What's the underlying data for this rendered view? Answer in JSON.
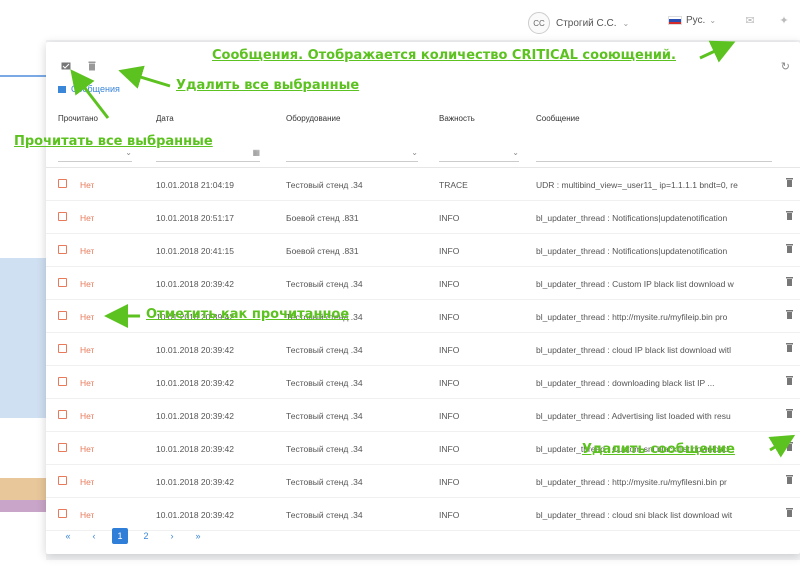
{
  "header": {
    "user_initials": "CC",
    "user_name": "Строгий С.С.",
    "language": "Рус."
  },
  "toolbar": {
    "read_all_icon": "envelope-check-icon",
    "delete_all_icon": "trash-icon",
    "refresh_icon": "refresh-icon"
  },
  "tab": {
    "label": "Сообщения"
  },
  "table": {
    "columns": [
      "Прочитано",
      "Дата",
      "Оборудование",
      "Важность",
      "Сообщение"
    ],
    "rows": [
      {
        "read": "Нет",
        "date": "10.01.2018 21:04:19",
        "equipment": "Тестовый стенд .34",
        "severity": "TRACE",
        "message": "UDR : multibind_view=_user11_ ip=1.1.1.1 bndt=0, re"
      },
      {
        "read": "Нет",
        "date": "10.01.2018 20:51:17",
        "equipment": "Боевой стенд .831",
        "severity": "INFO",
        "message": "bl_updater_thread : Notifications|updatenotification"
      },
      {
        "read": "Нет",
        "date": "10.01.2018 20:41:15",
        "equipment": "Боевой стенд .831",
        "severity": "INFO",
        "message": "bl_updater_thread : Notifications|updatenotification"
      },
      {
        "read": "Нет",
        "date": "10.01.2018 20:39:42",
        "equipment": "Тестовый стенд .34",
        "severity": "INFO",
        "message": "bl_updater_thread : Custom IP black list download w"
      },
      {
        "read": "Нет",
        "date": "10.01.2018 20:39:42",
        "equipment": "Тестовый стенд .34",
        "severity": "INFO",
        "message": "bl_updater_thread : http://mysite.ru/myfileip.bin pro"
      },
      {
        "read": "Нет",
        "date": "10.01.2018 20:39:42",
        "equipment": "Тестовый стенд .34",
        "severity": "INFO",
        "message": "bl_updater_thread : cloud IP black list download witl"
      },
      {
        "read": "Нет",
        "date": "10.01.2018 20:39:42",
        "equipment": "Тестовый стенд .34",
        "severity": "INFO",
        "message": "bl_updater_thread : downloading black list IP ..."
      },
      {
        "read": "Нет",
        "date": "10.01.2018 20:39:42",
        "equipment": "Тестовый стенд .34",
        "severity": "INFO",
        "message": "bl_updater_thread : Advertising list loaded with resu"
      },
      {
        "read": "Нет",
        "date": "10.01.2018 20:39:42",
        "equipment": "Тестовый стенд .34",
        "severity": "INFO",
        "message": "bl_updater_thread : Custom sni black list download"
      },
      {
        "read": "Нет",
        "date": "10.01.2018 20:39:42",
        "equipment": "Тестовый стенд .34",
        "severity": "INFO",
        "message": "bl_updater_thread : http://mysite.ru/myfilesni.bin pr"
      },
      {
        "read": "Нет",
        "date": "10.01.2018 20:39:42",
        "equipment": "Тестовый стенд .34",
        "severity": "INFO",
        "message": "bl_updater_thread : cloud sni black list download wit"
      }
    ]
  },
  "pagination": {
    "first": "«",
    "prev": "‹",
    "pages": [
      "1",
      "2"
    ],
    "current": "1",
    "next": "›",
    "last": "»"
  },
  "annotations": {
    "messages_note": "Сообщения. Отображается количество CRITICAL сооющений.",
    "delete_selected": "Удалить все выбранные",
    "read_selected": "Прочитать все выбранные",
    "mark_read": "Отметить как прочитанное",
    "delete_message": "Удалить сообщение"
  },
  "colors": {
    "accent": "#2f7ed8",
    "unread": "#e87a5a",
    "annotation": "#5cc21f"
  }
}
